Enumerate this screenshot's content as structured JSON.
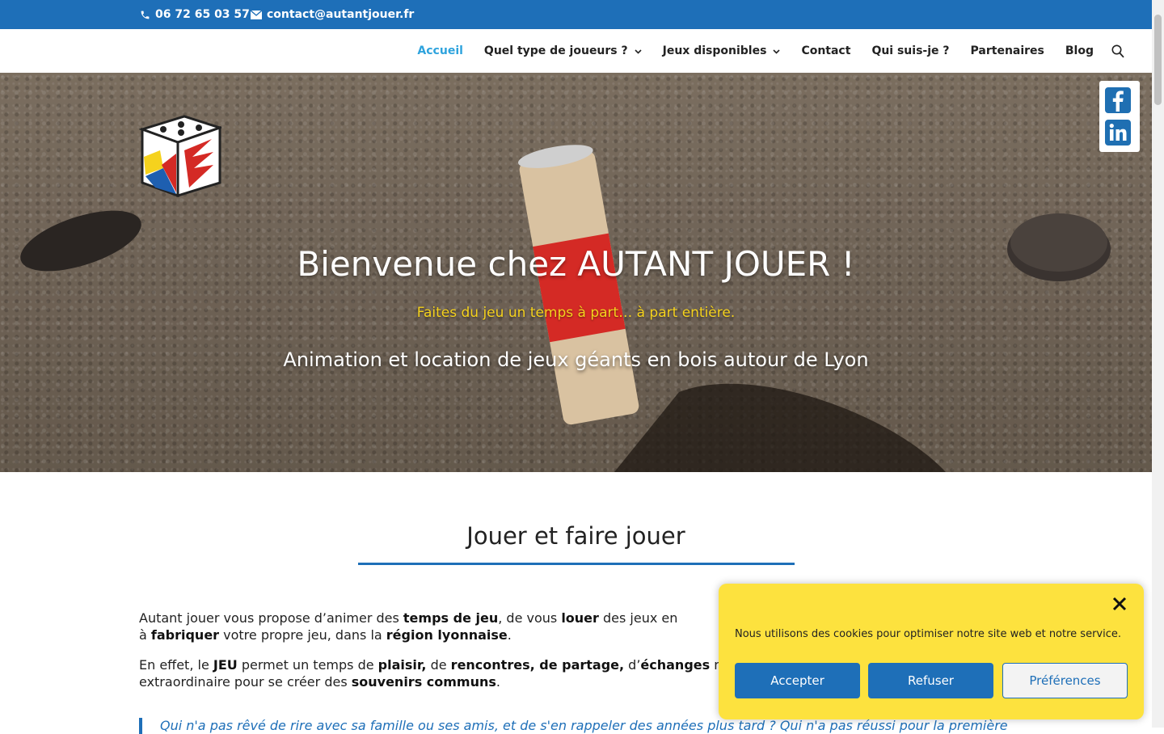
{
  "topbar": {
    "phone": "06 72 65 03 57",
    "email": "contact@autantjouer.fr",
    "phone_icon": "phone-icon",
    "email_icon": "envelope-icon"
  },
  "nav": {
    "items": [
      {
        "label": "Accueil",
        "active": true,
        "dropdown": false
      },
      {
        "label": "Quel type de joueurs ?",
        "active": false,
        "dropdown": true
      },
      {
        "label": "Jeux disponibles",
        "active": false,
        "dropdown": true
      },
      {
        "label": "Contact",
        "active": false,
        "dropdown": false
      },
      {
        "label": "Qui suis-je ?",
        "active": false,
        "dropdown": false
      },
      {
        "label": "Partenaires",
        "active": false,
        "dropdown": false
      },
      {
        "label": "Blog",
        "active": false,
        "dropdown": false
      }
    ],
    "search_icon": "search-icon"
  },
  "hero": {
    "title": "Bienvenue chez AUTANT JOUER !",
    "tagline": "Faites du jeu un temps à part… à part entière.",
    "subtitle": "Animation et location de jeux géants en bois autour de Lyon"
  },
  "social": {
    "facebook_icon": "facebook-icon",
    "linkedin_icon": "linkedin-icon"
  },
  "content": {
    "heading": "Jouer et faire jouer",
    "quote": "Qui n'a pas rêvé de rire avec sa famille ou ses amis, et de s'en rappeler des années plus tard ? Qui n'a pas réussi pour la première"
  },
  "cookie": {
    "message": "Nous utilisons des cookies pour optimiser notre site web et notre service.",
    "accept": "Accepter",
    "refuse": "Refuser",
    "preferences": "Préférences",
    "close_icon": "close-icon"
  },
  "colors": {
    "brand_blue": "#1e6fb8",
    "active_nav": "#2ea3dd",
    "tagline_yellow": "#f5d21d",
    "cookie_bg": "#fde23e"
  }
}
